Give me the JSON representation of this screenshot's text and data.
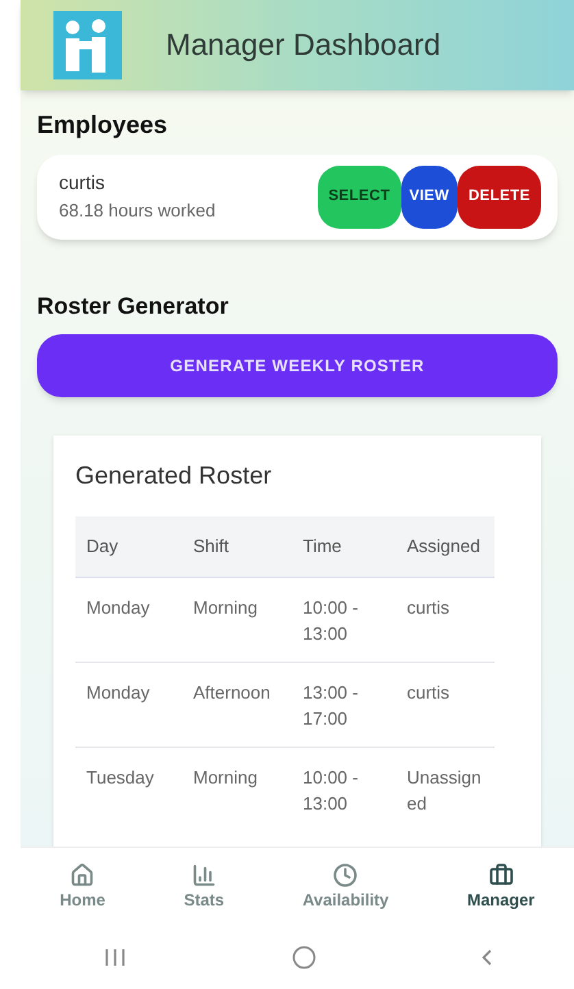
{
  "header": {
    "title": "Manager Dashboard"
  },
  "employees": {
    "title": "Employees",
    "items": [
      {
        "name": "curtis",
        "hours": "68.18 hours worked",
        "actions": [
          {
            "kind": "select",
            "label": "SELECT"
          },
          {
            "kind": "view",
            "label": "VIEW"
          },
          {
            "kind": "delete",
            "label": "DELETE"
          }
        ]
      }
    ]
  },
  "roster_generator": {
    "title": "Roster Generator",
    "button": "GENERATE WEEKLY ROSTER"
  },
  "generated_roster": {
    "title": "Generated Roster",
    "columns": [
      "Day",
      "Shift",
      "Time",
      "Assigned"
    ],
    "rows": [
      [
        "Monday",
        "Morning",
        "10:00 - 13:00",
        "curtis"
      ],
      [
        "Monday",
        "Afternoon",
        "13:00 - 17:00",
        "curtis"
      ],
      [
        "Tuesday",
        "Morning",
        "10:00 - 13:00",
        "Unassigned"
      ]
    ]
  },
  "bottom_nav": [
    {
      "kind": "home",
      "label": "Home",
      "selected": false
    },
    {
      "kind": "stats",
      "label": "Stats",
      "selected": false
    },
    {
      "kind": "availability",
      "label": "Availability",
      "selected": false
    },
    {
      "kind": "manager",
      "label": "Manager",
      "selected": true
    }
  ]
}
